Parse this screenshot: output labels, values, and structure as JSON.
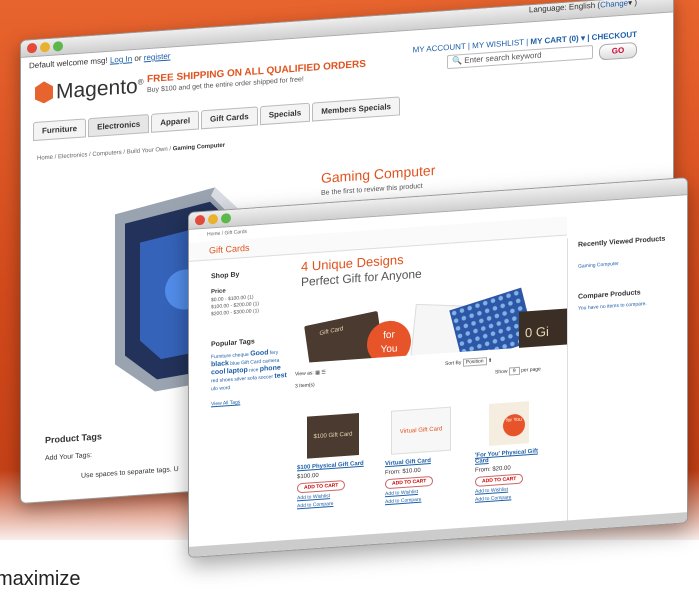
{
  "tagline": "maximize",
  "back_window": {
    "welcome": "Default welcome msg!",
    "login": "Log In",
    "or": "or",
    "register": "register",
    "language": "Language: English (",
    "change": "Change",
    "language_close": "▾ )",
    "logo": "Magento",
    "free_shipping": "FREE SHIPPING ON ALL QUALIFIED ORDERS",
    "free_sub": "Buy $100 and get the entire order shipped for free!",
    "links": "MY ACCOUNT | MY WISHLIST | ",
    "cart": "MY CART (0) ▾",
    "checkout": "| CHECKOUT",
    "search_placeholder": "Enter search keyword",
    "go": "GO",
    "nav": [
      "Furniture",
      "Electronics",
      "Apparel",
      "Gift Cards",
      "Specials",
      "Members Specials"
    ],
    "breadcrumb": "Home / Electronics / Computers / Build Your Own / ",
    "breadcrumb_current": "Gaming Computer",
    "product_title": "Gaming Computer",
    "review_first": "Be the first to review this product",
    "product_tags": "Product Tags",
    "add_tags": "Add Your Tags:",
    "use_spaces": "Use spaces to separate tags. U"
  },
  "front_window": {
    "breadcrumb": "Home / Gift Cards",
    "heading": "Gift Cards",
    "shop_by": "Shop By",
    "price_label": "Price",
    "price_ranges": [
      "$0.00 - $100.00 (1)",
      "$100.00 - $200.00 (1)",
      "$200.00 - $300.00 (1)"
    ],
    "popular_tags": "Popular Tags",
    "tags": [
      "Furniture",
      "cheque",
      "Good",
      "fery",
      "black",
      "blue",
      "Gift Card",
      "camera",
      "cool",
      "laptop",
      "nice",
      "phone",
      "red",
      "shoes",
      "silver",
      "sofa",
      "soccer",
      "test",
      "ufo",
      "word"
    ],
    "view_all_tags": "View All Tags",
    "banner_line1": "4 Unique Designs",
    "banner_line2": "Perfect Gift for Anyone",
    "banner_card_for": "for",
    "banner_card_you": "You",
    "banner_card_text": "0 Gi",
    "banner_card_gift": "Gift Card",
    "view_as": "View as:",
    "sort_by": "Sort By",
    "sort_value": "Position",
    "items_count": "3 Item(s)",
    "show": "Show",
    "show_value": "9",
    "per_page": "per page",
    "products": [
      {
        "name": "$100 Physical Gift Card",
        "price": "$100.00",
        "image_text": "$100 Gift Card"
      },
      {
        "name": "Virtual Gift Card",
        "price": "From: $10.00",
        "image_text": "Virtual Gift Card"
      },
      {
        "name": "'For You' Physical Gift Card",
        "price": "From: $20.00",
        "image_text": "for You"
      }
    ],
    "add_to_cart": "ADD TO CART",
    "add_to_wishlist": "Add to Wishlist",
    "add_to_compare": "Add to Compare",
    "recently_viewed": "Recently Viewed Products",
    "recent_item": "Gaming Computer",
    "compare_products": "Compare Products",
    "compare_empty": "You have no items to compare."
  },
  "colors": {
    "accent": "#e0531e",
    "link": "#1e5fa8",
    "background": "#d14a1c"
  }
}
